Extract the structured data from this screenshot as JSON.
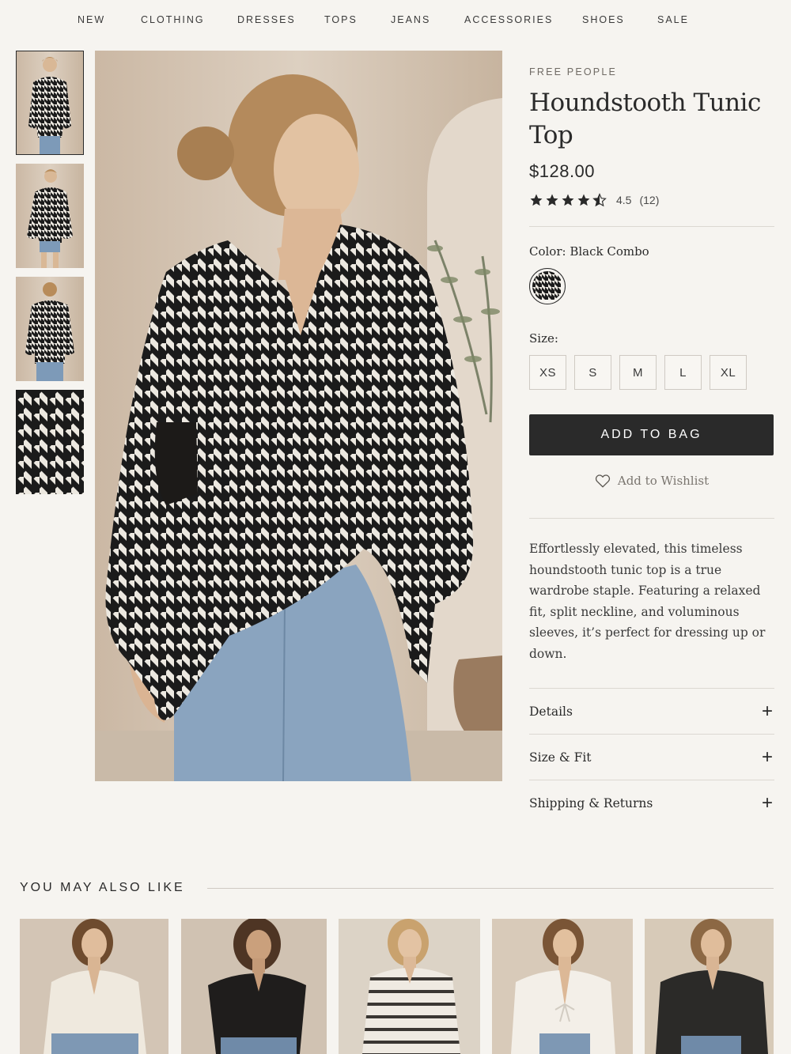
{
  "nav": {
    "items": [
      "NEW",
      "CLOTHING",
      "DRESSES",
      "TOPS",
      "JEANS",
      "ACCESSORIES",
      "SHOES",
      "SALE"
    ]
  },
  "product": {
    "brand": "FREE PEOPLE",
    "title_line1": "Houndstooth Tunic",
    "title_line2": "Top",
    "price": "$128.00",
    "rating_value": 4.5,
    "rating_text": "4.5",
    "review_count": "(12)",
    "color_label": "Color: Black Combo",
    "size_label": "Size:",
    "sizes": [
      "XS",
      "S",
      "M",
      "L",
      "XL"
    ],
    "add_to_bag": "ADD TO BAG",
    "wishlist": "Add to Wishlist",
    "description": "Effortlessly elevated, this timeless houndstooth tunic top is a true wardrobe staple. Featuring a relaxed fit, split neckline, and voluminous sleeves, it’s perfect for dressing up or down.",
    "accordion": [
      "Details",
      "Size & Fit",
      "Shipping & Returns"
    ]
  },
  "recommendations": {
    "title": "YOU MAY ALSO LIKE"
  },
  "colors": {
    "background": "#f6f4f0",
    "ink": "#2a2a2a",
    "button": "#2a2a2a",
    "muted": "#7a756f"
  }
}
